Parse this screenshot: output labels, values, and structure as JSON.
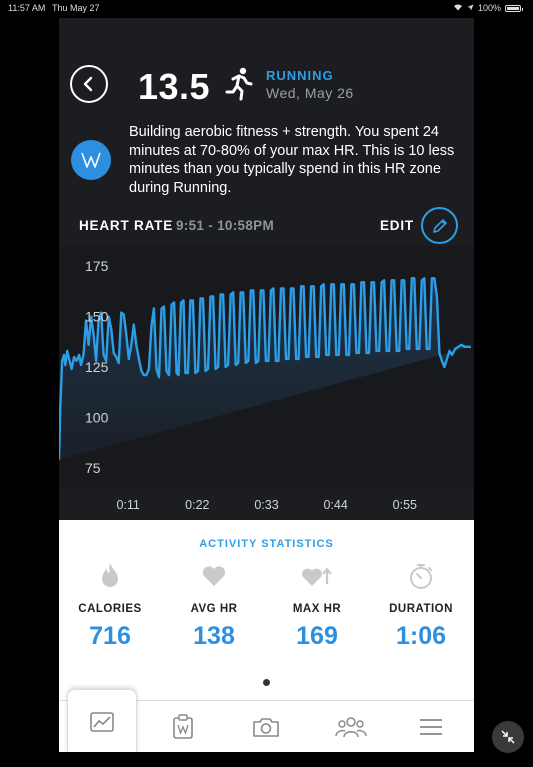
{
  "status_bar": {
    "time": "11:57 AM",
    "date": "Thu May 27",
    "battery": "100%"
  },
  "header": {
    "score": "13.5",
    "activity": "RUNNING",
    "date": "Wed, May 26",
    "icons": {
      "back": "chevron-left-icon",
      "activity": "runner-icon"
    }
  },
  "insight": {
    "badge": "W",
    "text": "Building aerobic fitness + strength. You spent 24 minutes at 70-80% of your max HR. This is 10 less minutes than you typically spend in this HR zone during Running."
  },
  "heart_rate": {
    "label": "HEART RATE",
    "time_range": "9:51 - 10:58PM",
    "edit_label": "EDIT"
  },
  "chart_data": {
    "type": "area",
    "y_ticks": [
      "175",
      "150",
      "125",
      "100",
      "75"
    ],
    "x_ticks": [
      "0:11",
      "0:22",
      "0:33",
      "0:44",
      "0:55"
    ],
    "ylim": [
      65,
      185
    ],
    "xlim": [
      0,
      66
    ],
    "color": "#2d9ee6",
    "x": [
      0,
      0.2,
      0.5,
      0.8,
      1.0,
      1.3,
      1.6,
      2.0,
      2.4,
      2.8,
      3.2,
      3.5,
      3.9,
      4.3,
      4.7,
      5.1,
      5.5,
      5.9,
      6.3,
      6.7,
      7.1,
      7.5,
      7.9,
      8.3,
      8.7,
      9.1,
      9.5,
      9.9,
      10.3,
      10.7,
      11.1,
      11.5,
      11.9,
      12.3,
      12.7,
      13.1,
      13.5,
      13.9,
      14.3,
      14.7,
      15.1,
      15.5,
      15.9,
      16.3,
      16.7,
      17.1,
      17.5,
      17.9,
      18.3,
      18.7,
      19.0,
      19.4,
      19.8,
      20.1,
      20.5,
      20.9,
      21.3,
      21.7,
      22.1,
      22.5,
      22.9,
      23.3,
      23.7,
      24.1,
      24.5,
      24.9,
      25.3,
      25.7,
      26.1,
      26.5,
      26.9,
      27.3,
      27.7,
      28.1,
      28.5,
      28.9,
      29.3,
      29.7,
      30.1,
      30.5,
      30.9,
      31.3,
      31.7,
      32.1,
      32.5,
      32.9,
      33.3,
      33.7,
      34.1,
      34.5,
      34.9,
      35.3,
      35.7,
      36.1,
      36.5,
      36.9,
      37.3,
      37.7,
      38.1,
      38.5,
      38.9,
      39.3,
      39.7,
      40.1,
      40.5,
      40.9,
      41.3,
      41.7,
      42.1,
      42.5,
      42.9,
      43.3,
      43.7,
      44.1,
      44.5,
      44.9,
      45.3,
      45.7,
      46.1,
      46.5,
      46.9,
      47.3,
      47.7,
      48.1,
      48.5,
      48.9,
      49.3,
      49.7,
      50.1,
      50.5,
      50.9,
      51.3,
      51.7,
      52.1,
      52.5,
      52.9,
      53.3,
      53.7,
      54.1,
      54.5,
      54.9,
      55.3,
      55.7,
      56.1,
      56.5,
      56.9,
      57.3,
      57.7,
      58.1,
      58.5,
      58.9,
      59.3,
      59.7,
      60.1,
      60.5,
      60.9,
      61.3,
      61.7,
      62.1,
      62.5,
      63.0,
      63.5,
      64.0,
      64.5,
      65.0,
      65.5,
      66.0
    ],
    "y": [
      79,
      105,
      128,
      131,
      126,
      133,
      129,
      124,
      130,
      128,
      131,
      126,
      131,
      148,
      136,
      150,
      141,
      128,
      148,
      152,
      131,
      128,
      150,
      144,
      132,
      130,
      127,
      152,
      151,
      141,
      129,
      136,
      146,
      136,
      129,
      123,
      121,
      121,
      124,
      145,
      154,
      124,
      120,
      154,
      155,
      123,
      121,
      156,
      157,
      122,
      121,
      157,
      158,
      122,
      122,
      158,
      158,
      122,
      123,
      159,
      159,
      123,
      124,
      160,
      160,
      124,
      125,
      161,
      161,
      125,
      126,
      161,
      162,
      126,
      127,
      162,
      162,
      127,
      128,
      163,
      163,
      127,
      128,
      163,
      163,
      128,
      128,
      163,
      164,
      128,
      128,
      164,
      164,
      129,
      129,
      164,
      164,
      129,
      129,
      165,
      165,
      130,
      130,
      165,
      165,
      130,
      130,
      165,
      166,
      131,
      131,
      166,
      166,
      131,
      131,
      166,
      166,
      131,
      131,
      166,
      166,
      132,
      132,
      167,
      167,
      132,
      132,
      167,
      167,
      133,
      133,
      167,
      168,
      133,
      133,
      168,
      168,
      133,
      133,
      168,
      168,
      134,
      134,
      169,
      169,
      134,
      134,
      168,
      169,
      134,
      134,
      169,
      169,
      160,
      132,
      128,
      125,
      129,
      133,
      131,
      134,
      135,
      136,
      135,
      135,
      135
    ]
  },
  "statistics": {
    "title": "ACTIVITY STATISTICS",
    "items": [
      {
        "label": "CALORIES",
        "value": "716",
        "icon": "flame-icon"
      },
      {
        "label": "AVG HR",
        "value": "138",
        "icon": "heart-icon"
      },
      {
        "label": "MAX HR",
        "value": "169",
        "icon": "heart-up-icon"
      },
      {
        "label": "DURATION",
        "value": "1:06",
        "icon": "stopwatch-icon"
      }
    ]
  },
  "tabs": [
    {
      "name": "overview",
      "icon": "trend-icon",
      "active": true
    },
    {
      "name": "journal",
      "icon": "journal-icon",
      "active": false
    },
    {
      "name": "camera",
      "icon": "camera-icon",
      "active": false
    },
    {
      "name": "community",
      "icon": "people-icon",
      "active": false
    },
    {
      "name": "menu",
      "icon": "hamburger-icon",
      "active": false
    }
  ]
}
